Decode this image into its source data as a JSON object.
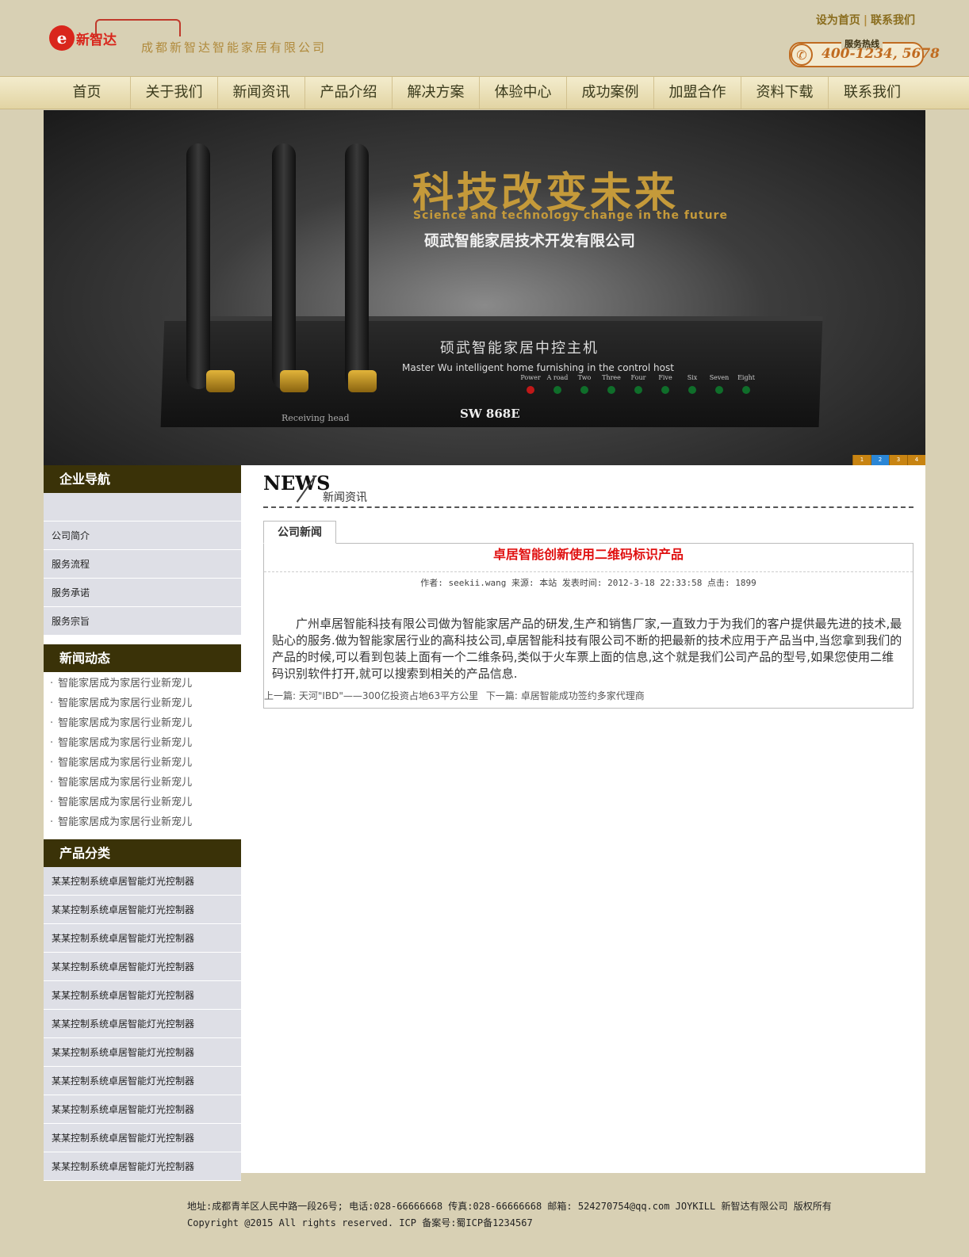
{
  "header": {
    "company_name": "成都新智达智能家居有限公司",
    "logo_text": "新智达",
    "top_links": [
      "设为首页",
      "联系我们"
    ],
    "hotline_label": "服务热线",
    "hotline_number": "400-1234, 5678"
  },
  "nav": [
    "首页",
    "关于我们",
    "新闻资讯",
    "产品介绍",
    "解决方案",
    "体验中心",
    "成功案例",
    "加盟合作",
    "资料下载",
    "联系我们"
  ],
  "banner": {
    "title": "科技改变未来",
    "subtitle": "Science and technology change in the future",
    "company": "硕武智能家居技术开发有限公司",
    "device_cn": "硕武智能家居中控主机",
    "device_en": "Master Wu intelligent home furnishing in the control host",
    "device_model": "SW 868E",
    "device_receiver": "Receiving head",
    "led_labels": [
      "Power",
      "A road",
      "Two",
      "Three",
      "Four",
      "Five",
      "Six",
      "Seven",
      "Eight"
    ],
    "dots": [
      "1",
      "2",
      "3",
      "4"
    ],
    "active_dot": 1
  },
  "sidebar": {
    "nav_title": "企业导航",
    "nav_items": [
      "",
      "公司简介",
      "服务流程",
      "服务承诺",
      "服务宗旨"
    ],
    "news_title": "新闻动态",
    "news_items": [
      "智能家居成为家居行业新宠儿",
      "智能家居成为家居行业新宠儿",
      "智能家居成为家居行业新宠儿",
      "智能家居成为家居行业新宠儿",
      "智能家居成为家居行业新宠儿",
      "智能家居成为家居行业新宠儿",
      "智能家居成为家居行业新宠儿",
      "智能家居成为家居行业新宠儿"
    ],
    "product_title": "产品分类",
    "product_items": [
      "某某控制系统卓居智能灯光控制器",
      "某某控制系统卓居智能灯光控制器",
      "某某控制系统卓居智能灯光控制器",
      "某某控制系统卓居智能灯光控制器",
      "某某控制系统卓居智能灯光控制器",
      "某某控制系统卓居智能灯光控制器",
      "某某控制系统卓居智能灯光控制器",
      "某某控制系统卓居智能灯光控制器",
      "某某控制系统卓居智能灯光控制器",
      "某某控制系统卓居智能灯光控制器",
      "某某控制系统卓居智能灯光控制器"
    ]
  },
  "main": {
    "news_en": "NEWS",
    "news_cn": "新闻资讯",
    "tab": "公司新闻",
    "article_title": "卓居智能创新使用二维码标识产品",
    "article_meta": "作者: seekii.wang 来源: 本站 发表时间: 2012-3-18 22:33:58 点击: 1899",
    "article_body": "广州卓居智能科技有限公司做为智能家居产品的研发,生产和销售厂家,一直致力于为我们的客户提供最先进的技术,最贴心的服务.做为智能家居行业的高科技公司,卓居智能科技有限公司不断的把最新的技术应用于产品当中,当您拿到我们的产品的时候,可以看到包装上面有一个二维条码,类似于火车票上面的信息,这个就是我们公司产品的型号,如果您使用二维码识别软件打开,就可以搜索到相关的产品信息.",
    "prev": "上一篇: 天河\"IBD\"——300亿投资占地63平方公里",
    "next": "下一篇: 卓居智能成功签约多家代理商"
  },
  "footer": {
    "line1": "地址:成都青羊区人民中路一段26号; 电话:028-66666668 传真:028-66666668 邮箱: 524270754@qq.com JOYKILL 新智达有限公司 版权所有",
    "line2": "Copyright @2015 All rights reserved. ICP 备案号:蜀ICP备1234567"
  }
}
